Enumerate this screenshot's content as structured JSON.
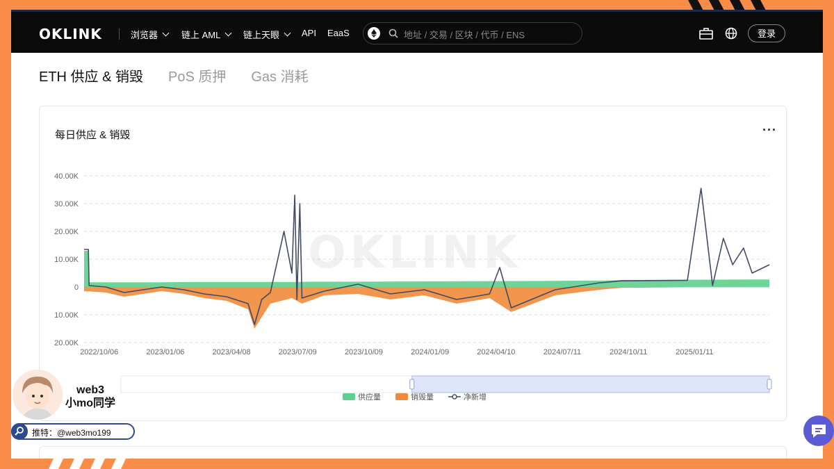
{
  "topbar": {
    "logo": "OKLINK",
    "nav": [
      "浏览器",
      "链上 AML",
      "链上天眼",
      "API",
      "EaaS"
    ],
    "search_placeholder": "地址 / 交易 / 区块 / 代币 / ENS",
    "login": "登录",
    "icons": [
      "ethereum-icon",
      "search-icon",
      "briefcase-icon",
      "globe-icon"
    ]
  },
  "tabs": [
    "ETH 供应 & 销毁",
    "PoS 质押",
    "Gas 消耗"
  ],
  "card": {
    "title": "每日供应 & 销毁",
    "more": "···",
    "watermark": "OKLINK"
  },
  "colors": {
    "supply": "#5fcf8e",
    "burn": "#f1893a",
    "net": "#3f4b63",
    "accent": "#f98c46"
  },
  "chart_data": {
    "type": "area",
    "xlabel": "",
    "ylabel": "",
    "ylim": [
      -20000,
      40000
    ],
    "y_ticks": [
      "40.00K",
      "30.00K",
      "20.00K",
      "10.00K",
      "0",
      "10.00K",
      "20.00K"
    ],
    "x_ticks": [
      "2022/10/06",
      "2023/01/06",
      "2023/04/08",
      "2023/07/09",
      "2023/10/09",
      "2024/01/09",
      "2024/04/10",
      "2024/07/11",
      "2024/10/11",
      "2025/01/11"
    ],
    "grid": true,
    "legend_position": "bottom-center",
    "series": [
      {
        "name": "供应量",
        "dates": [
          "2022-09-15",
          "2022-09-21",
          "2022-09-22",
          "2022-10-15",
          "2023-01-01",
          "2023-03-01",
          "2023-04-01",
          "2023-05-10",
          "2023-06-01",
          "2023-07-05",
          "2023-08-01",
          "2023-10-01",
          "2024-01-01",
          "2024-04-01",
          "2024-07-01",
          "2024-09-10",
          "2024-10-01",
          "2025-01-01",
          "2025-04-01",
          "2025-04-25"
        ],
        "values": [
          13000,
          13000,
          1700,
          1700,
          1700,
          1800,
          1800,
          1800,
          1800,
          1800,
          1900,
          1900,
          2000,
          2100,
          2200,
          2300,
          2500,
          2600,
          2700,
          2700
        ]
      },
      {
        "name": "销毁量",
        "dates": [
          "2022-09-15",
          "2022-10-15",
          "2022-11-10",
          "2023-01-01",
          "2023-02-01",
          "2023-03-01",
          "2023-04-01",
          "2023-05-01",
          "2023-05-10",
          "2023-06-01",
          "2023-07-01",
          "2023-07-15",
          "2023-08-15",
          "2023-10-01",
          "2023-11-15",
          "2024-01-01",
          "2024-02-15",
          "2024-03-10",
          "2024-04-01",
          "2024-05-01",
          "2024-07-01",
          "2024-09-01",
          "2024-10-01",
          "2025-01-01",
          "2025-04-25"
        ],
        "values": [
          -1500,
          -2000,
          -3500,
          -1500,
          -2500,
          -4000,
          -5000,
          -8000,
          -15000,
          -6000,
          -4000,
          -6000,
          -3000,
          -2500,
          -4500,
          -3000,
          -6000,
          -5000,
          -4000,
          -9000,
          -3000,
          -1000,
          -300,
          -100,
          -100
        ]
      },
      {
        "name": "净新增",
        "dates": [
          "2022-09-15",
          "2022-09-21",
          "2022-09-22",
          "2022-10-15",
          "2022-11-10",
          "2023-01-01",
          "2023-02-01",
          "2023-03-01",
          "2023-04-01",
          "2023-05-01",
          "2023-05-10",
          "2023-05-20",
          "2023-06-01",
          "2023-06-20",
          "2023-07-01",
          "2023-07-05",
          "2023-07-08",
          "2023-07-12",
          "2023-07-15",
          "2023-08-15",
          "2023-10-01",
          "2023-11-15",
          "2024-01-01",
          "2024-02-15",
          "2024-03-10",
          "2024-04-01",
          "2024-04-15",
          "2024-05-01",
          "2024-07-01",
          "2024-09-01",
          "2024-10-01",
          "2025-01-01",
          "2025-01-20",
          "2025-02-05",
          "2025-02-20",
          "2025-03-05",
          "2025-03-20",
          "2025-04-01",
          "2025-04-25"
        ],
        "values": [
          13500,
          13500,
          500,
          0,
          -2000,
          0,
          -1000,
          -2500,
          -3500,
          -6000,
          -13500,
          -4500,
          -2000,
          20000,
          5000,
          33000,
          -4500,
          30000,
          -4000,
          -1500,
          1000,
          -2500,
          -1000,
          -4500,
          -3500,
          -2500,
          7000,
          -7500,
          -1000,
          1500,
          2200,
          2400,
          35500,
          500,
          17500,
          8000,
          14000,
          5000,
          8000
        ]
      }
    ]
  },
  "watermark_badge": {
    "line1": "web3",
    "line2": "小mo同学",
    "handle": "推特：@web3mo199"
  }
}
